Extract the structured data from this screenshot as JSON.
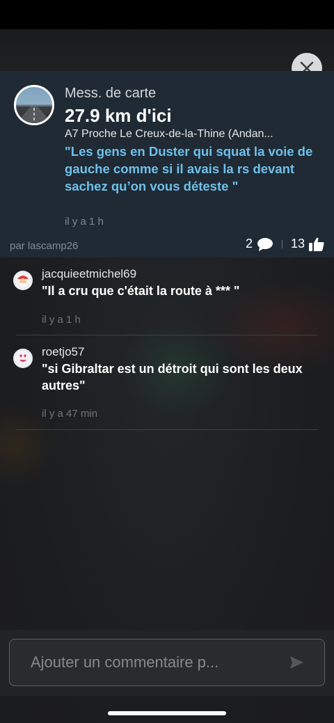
{
  "card": {
    "type_label": "Mess. de carte",
    "distance": "27.9 km d'ici",
    "location": "A7 Proche Le Creux-de-la-Thine (Andan...",
    "message": "\"Les gens en Duster qui squat la voie de gauche comme si il avais la rs devant sachez qu’on vous déteste \"",
    "time": "il y a 1 h",
    "author": "par lascamp26",
    "comment_count": "2",
    "like_count": "13",
    "close_icon": "close-icon"
  },
  "comments": [
    {
      "username": "jacquieetmichel69",
      "text": "\"Il a cru que c'était la route à *** \"",
      "time": "il y a 1 h",
      "avatar_icon": "santa-avatar-icon"
    },
    {
      "username": "roetjo57",
      "text": "\"si Gibraltar est un détroit qui sont les deux autres\"",
      "time": "il y a 47 min",
      "avatar_icon": "heart-eyes-avatar-icon"
    }
  ],
  "composer": {
    "placeholder": "Ajouter un commentaire p...",
    "value": "",
    "send_icon": "send-icon"
  },
  "colors": {
    "message_accent": "#6fc0ea",
    "card_background": "#1f2a34",
    "page_background": "#1d1e20"
  }
}
